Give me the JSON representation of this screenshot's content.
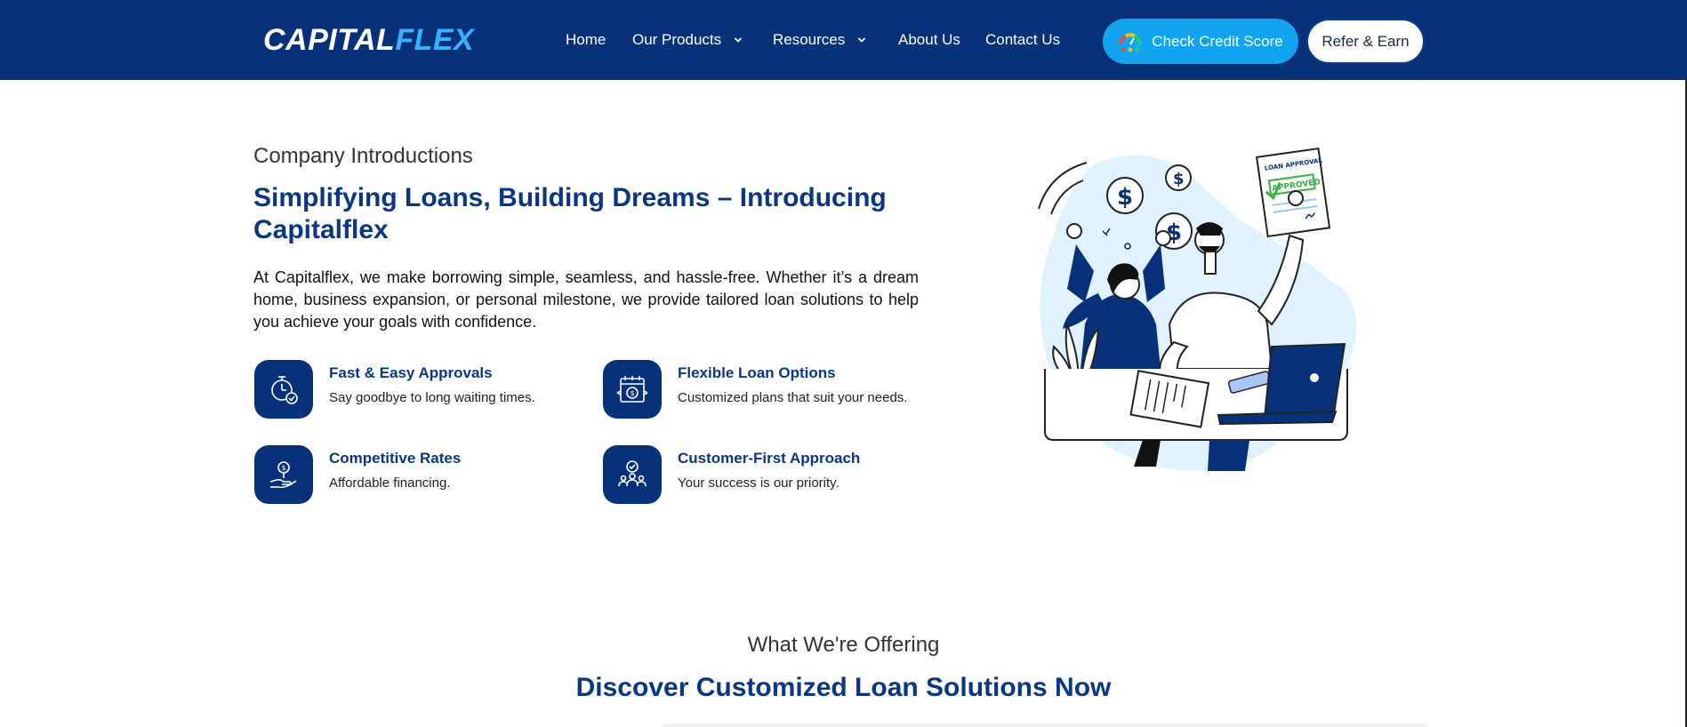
{
  "header": {
    "logo": {
      "part1": "CAPITAL",
      "part2": "FLEX"
    },
    "nav": [
      {
        "label": "Home",
        "has_dropdown": false
      },
      {
        "label": "Our Products",
        "has_dropdown": true
      },
      {
        "label": "Resources",
        "has_dropdown": true
      },
      {
        "label": "About Us",
        "has_dropdown": false
      },
      {
        "label": "Contact Us",
        "has_dropdown": false
      }
    ],
    "cta_primary": "Check Credit Score",
    "cta_secondary": "Refer & Earn"
  },
  "intro": {
    "eyebrow": "Company Introductions",
    "title": "Simplifying Loans, Building Dreams – Introducing Capitalflex",
    "description": "At Capitalflex, we make borrowing simple, seamless, and hassle-free. Whether it’s a dream home, business expansion, or personal milestone, we provide tailored loan solutions to help you achieve your goals with confidence.",
    "features": [
      {
        "icon": "clock-check-icon",
        "title": "Fast & Easy Approvals",
        "desc": "Say goodbye to long waiting times."
      },
      {
        "icon": "calendar-money-icon",
        "title": "Flexible Loan Options",
        "desc": "Customized plans that suit your needs."
      },
      {
        "icon": "hand-coin-icon",
        "title": "Competitive Rates",
        "desc": "Affordable financing."
      },
      {
        "icon": "customer-group-icon",
        "title": "Customer-First Approach",
        "desc": "Your success is our priority."
      }
    ],
    "illustration": {
      "icon": "loan-approval-illustration",
      "document_title": "LOAN APPROVAL",
      "stamp": "APPROVED"
    }
  },
  "offering": {
    "eyebrow": "What We're Offering",
    "title": "Discover Customized Loan Solutions Now"
  },
  "colors": {
    "navy": "#07327a",
    "accent_blue": "#12a3f1",
    "heading_blue": "#0b3684"
  }
}
